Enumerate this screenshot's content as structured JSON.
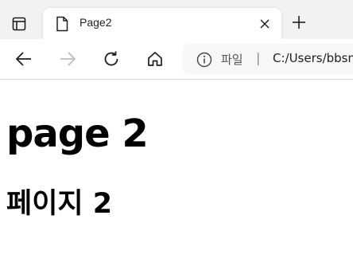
{
  "browser": {
    "tab": {
      "title": "Page2"
    },
    "address_bar": {
      "scheme_label": "파일",
      "separator": "|",
      "url": "C:/Users/bbsm"
    },
    "toolbar": {
      "icons": [
        "back-icon",
        "forward-icon",
        "refresh-icon",
        "home-icon",
        "info-icon"
      ]
    }
  },
  "page": {
    "heading": "page 2",
    "subheading": "페이지 2"
  }
}
